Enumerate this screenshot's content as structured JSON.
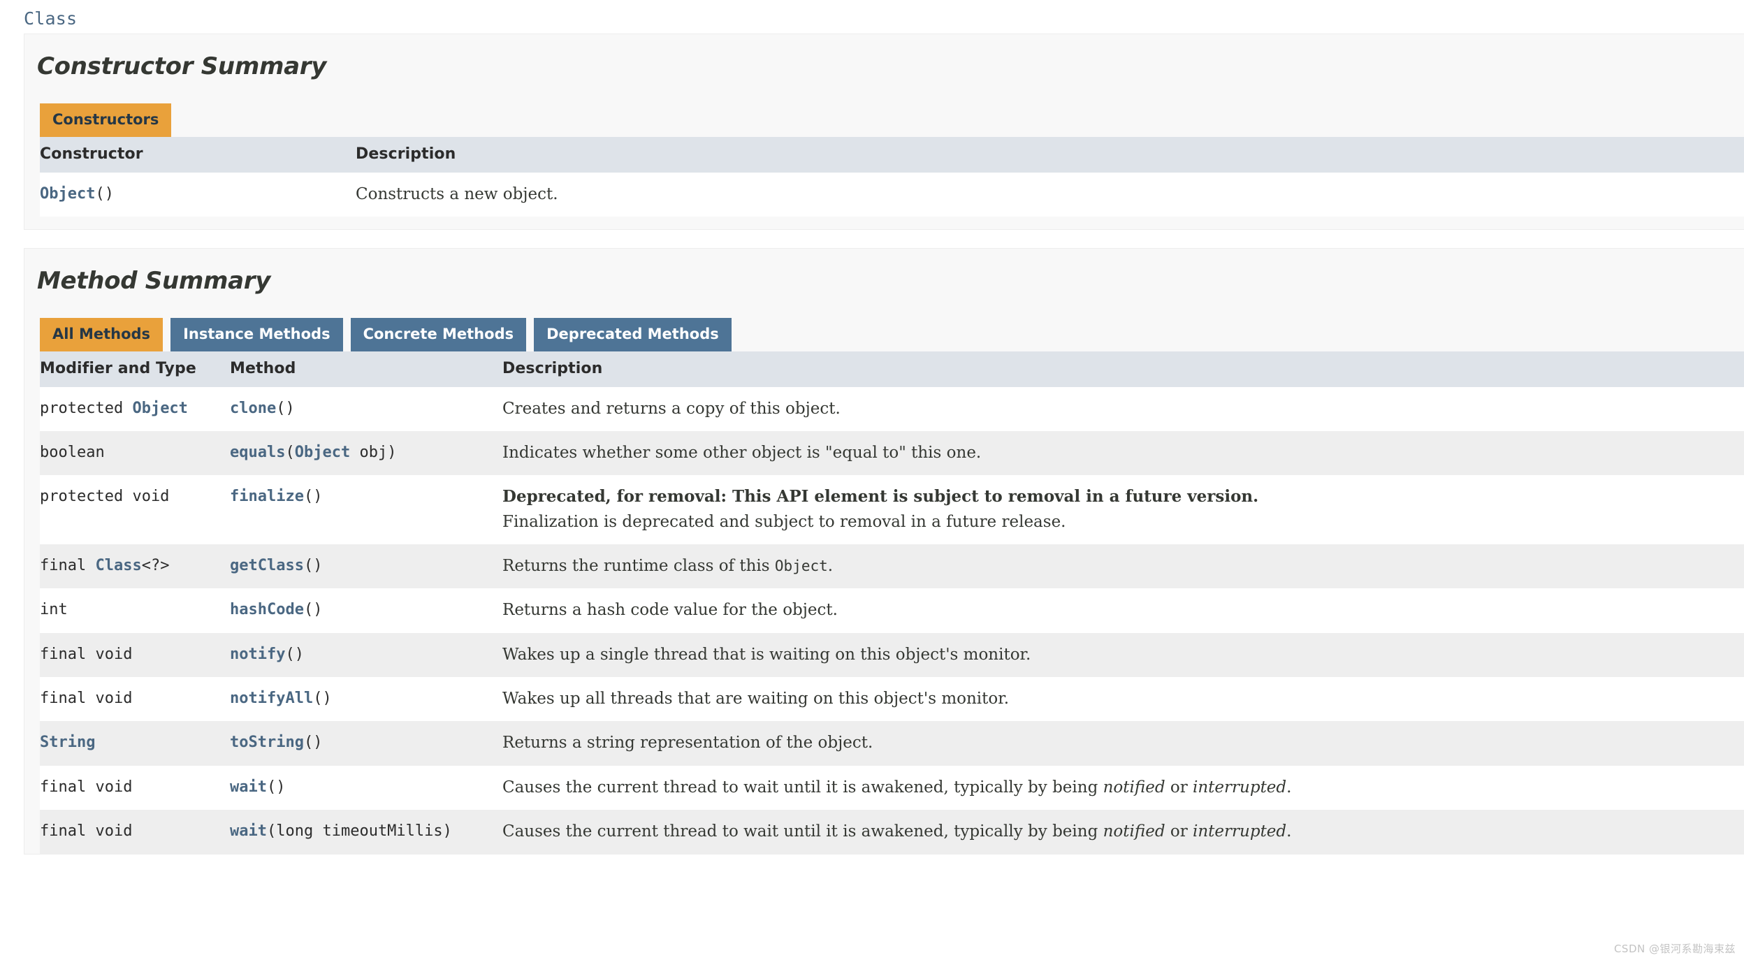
{
  "page": {
    "class_label": "Class",
    "watermark": "CSDN @银河系勘海束兹"
  },
  "colors": {
    "accent_orange": "#e9a13b",
    "tab_blue": "#4e7496",
    "link_blue": "#4a6782",
    "table_header_bg": "#dee3e9",
    "section_bg": "#f8f8f8",
    "row_alt_bg": "#eeeeee",
    "text": "#353833"
  },
  "constructor_summary": {
    "title": "Constructor Summary",
    "tabs": [
      {
        "label": "Constructors",
        "active": true
      }
    ],
    "headers": [
      "Constructor",
      "Description"
    ],
    "rows": [
      {
        "constructor_link": "Object",
        "constructor_suffix": "()",
        "description": "Constructs a new object."
      }
    ]
  },
  "method_summary": {
    "title": "Method Summary",
    "tabs": [
      {
        "label": "All Methods",
        "active": true
      },
      {
        "label": "Instance Methods",
        "active": false
      },
      {
        "label": "Concrete Methods",
        "active": false
      },
      {
        "label": "Deprecated Methods",
        "active": false
      }
    ],
    "headers": [
      "Modifier and Type",
      "Method",
      "Description"
    ],
    "rows": [
      {
        "modifier_prefix": "protected ",
        "modifier_link": "Object",
        "modifier_suffix": "",
        "method_link": "clone",
        "method_args": "()",
        "description": "Creates and returns a copy of this object.",
        "deprecated": false
      },
      {
        "modifier_prefix": "boolean",
        "modifier_link": "",
        "modifier_suffix": "",
        "method_link": "equals",
        "method_args": "(Object obj)",
        "method_arg_type": "Object",
        "method_arg_name": "obj",
        "description": "Indicates whether some other object is \"equal to\" this one.",
        "deprecated": false
      },
      {
        "modifier_prefix": "protected void",
        "modifier_link": "",
        "modifier_suffix": "",
        "method_link": "finalize",
        "method_args": "()",
        "deprecated": true,
        "deprecated_headline": "Deprecated, for removal: This API element is subject to removal in a future version.",
        "description": "Finalization is deprecated and subject to removal in a future release."
      },
      {
        "modifier_prefix": "final ",
        "modifier_link": "Class",
        "modifier_suffix": "<?>",
        "method_link": "getClass",
        "method_args": "()",
        "description_pre": "Returns the runtime class of this ",
        "description_code": "Object",
        "description_post": ".",
        "description": "Returns the runtime class of this Object.",
        "deprecated": false
      },
      {
        "modifier_prefix": "int",
        "modifier_link": "",
        "modifier_suffix": "",
        "method_link": "hashCode",
        "method_args": "()",
        "description": "Returns a hash code value for the object.",
        "deprecated": false
      },
      {
        "modifier_prefix": "final void",
        "modifier_link": "",
        "modifier_suffix": "",
        "method_link": "notify",
        "method_args": "()",
        "description": "Wakes up a single thread that is waiting on this object's monitor.",
        "deprecated": false
      },
      {
        "modifier_prefix": "final void",
        "modifier_link": "",
        "modifier_suffix": "",
        "method_link": "notifyAll",
        "method_args": "()",
        "description": "Wakes up all threads that are waiting on this object's monitor.",
        "deprecated": false
      },
      {
        "modifier_prefix": "",
        "modifier_link": "String",
        "modifier_suffix": "",
        "method_link": "toString",
        "method_args": "()",
        "description": "Returns a string representation of the object.",
        "deprecated": false
      },
      {
        "modifier_prefix": "final void",
        "modifier_link": "",
        "modifier_suffix": "",
        "method_link": "wait",
        "method_args": "()",
        "description_pre": "Causes the current thread to wait until it is awakened, typically by being ",
        "description_em1": "notified",
        "description_mid": " or ",
        "description_em2": "interrupted",
        "description_post": ".",
        "description": "Causes the current thread to wait until it is awakened, typically by being notified or interrupted.",
        "deprecated": false
      },
      {
        "modifier_prefix": "final void",
        "modifier_link": "",
        "modifier_suffix": "",
        "method_link": "wait",
        "method_args": "(long timeoutMillis)",
        "method_arg_type": "long",
        "method_arg_name": "timeoutMillis",
        "description_pre": "Causes the current thread to wait until it is awakened, typically by being ",
        "description_em1": "notified",
        "description_mid": " or ",
        "description_em2": "interrupted",
        "description_post": ".",
        "description": "Causes the current thread to wait until it is awakened, typically by being notified or interrupted.",
        "deprecated": false
      }
    ]
  }
}
